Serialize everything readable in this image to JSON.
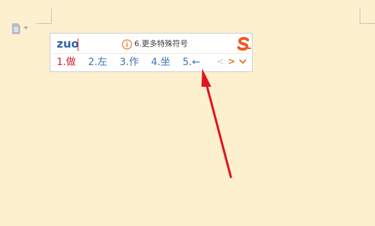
{
  "document": {
    "background_color": "#fdf0cf"
  },
  "ime": {
    "composition": "zuo",
    "tip": "6.更多特殊符号",
    "candidates": [
      {
        "index": "1.",
        "text": "做"
      },
      {
        "index": "2.",
        "text": "左"
      },
      {
        "index": "3.",
        "text": "作"
      },
      {
        "index": "4.",
        "text": "坐"
      },
      {
        "index": "5.",
        "text": "←"
      }
    ],
    "nav": {
      "prev": "<",
      "next": ">",
      "expand": "⌄"
    },
    "colors": {
      "accent": "#e07c2b",
      "highlight": "#d0192e",
      "candidate": "#3d70b7"
    }
  },
  "annotation": {
    "arrow_color": "#e0141e"
  }
}
